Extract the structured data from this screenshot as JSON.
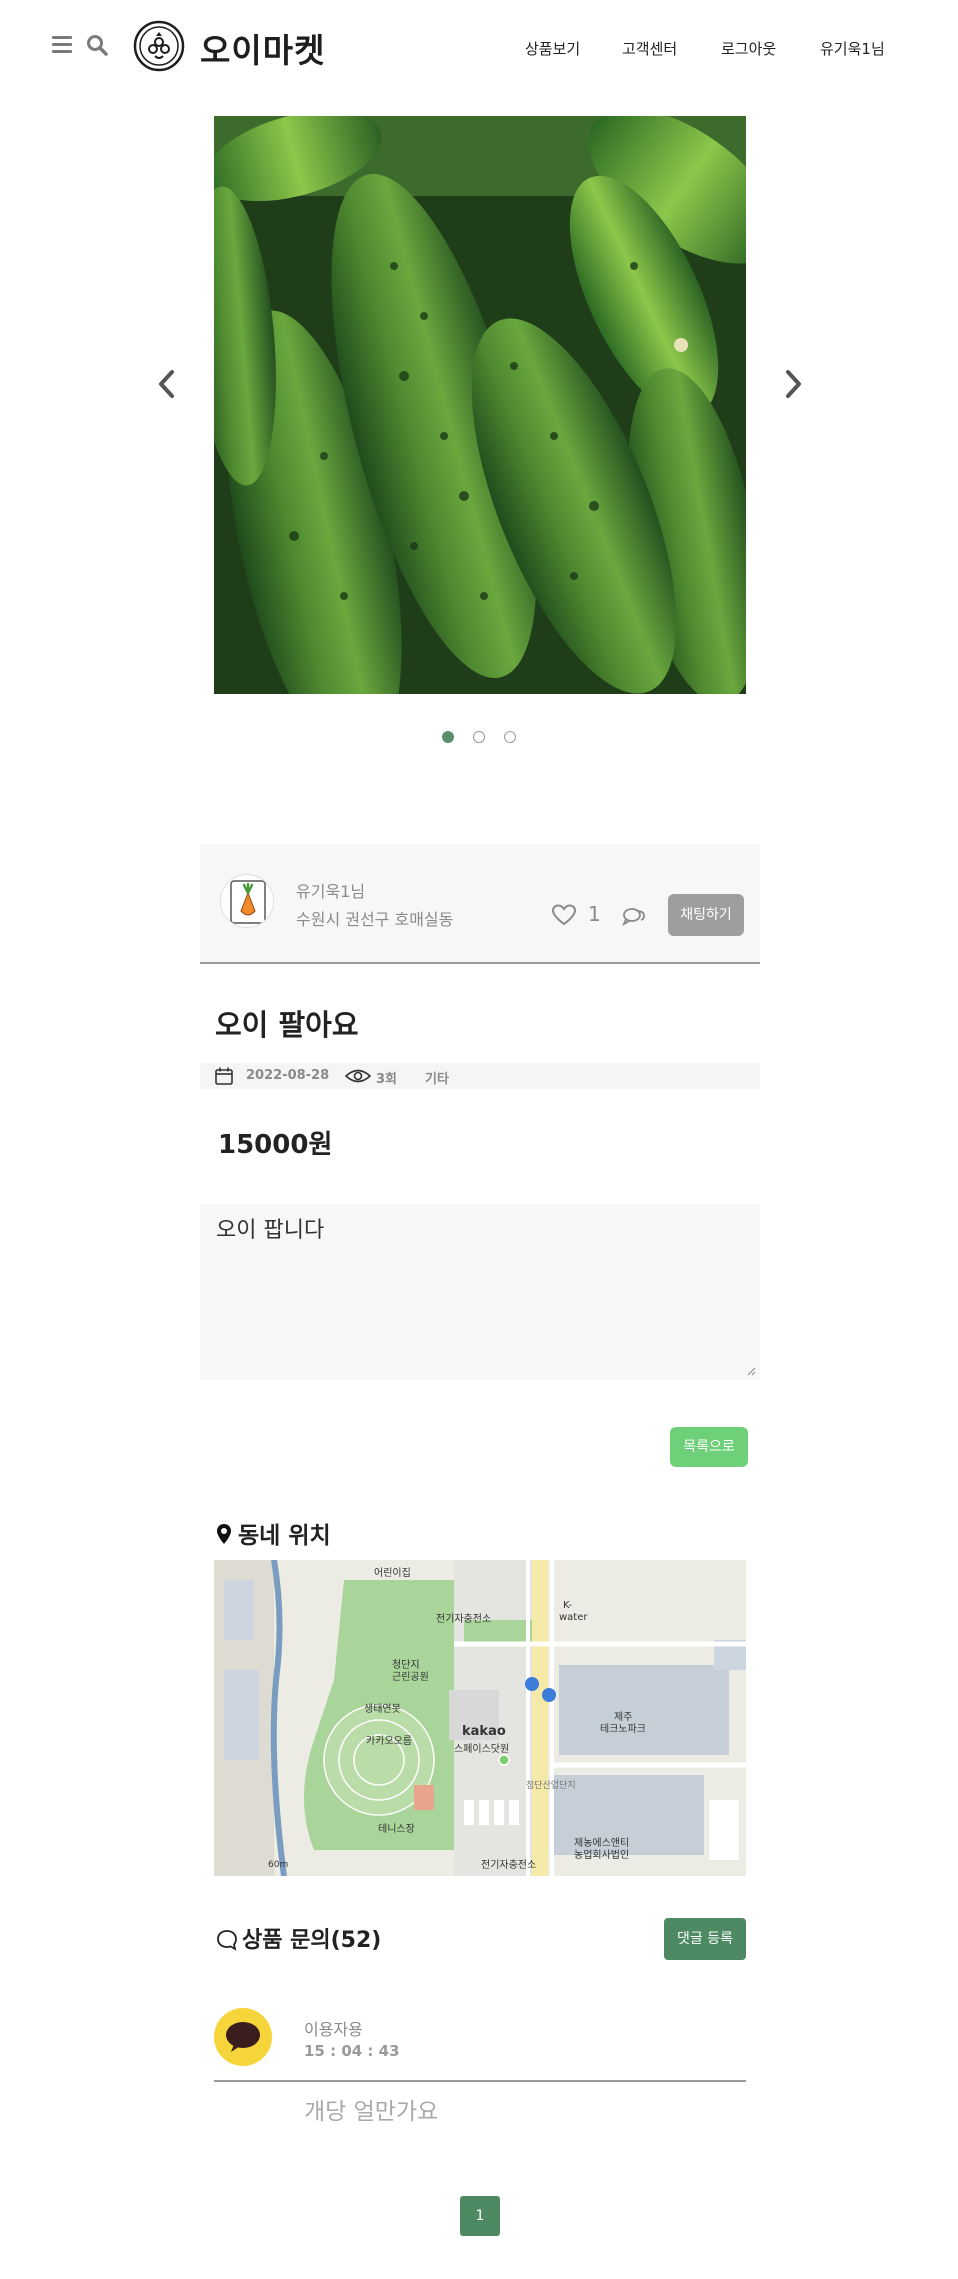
{
  "header": {
    "brand": "오이마켓",
    "nav": [
      {
        "label": "상품보기"
      },
      {
        "label": "고객센터"
      },
      {
        "label": "로그아웃"
      },
      {
        "label": "유기욱1님"
      }
    ]
  },
  "carousel": {
    "active_index": 0,
    "slides": 3
  },
  "seller": {
    "name": "유기욱1님",
    "location": "수원시 권선구 호매실동",
    "likes": "1",
    "chat_label": "채팅하기"
  },
  "post": {
    "title": "오이 팔아요",
    "date": "2022-08-28",
    "views": "3회",
    "category": "기타",
    "price": "15000원",
    "description": "오이 팝니다",
    "list_label": "목록으로"
  },
  "location": {
    "heading": "동네 위치",
    "map_labels": {
      "a": "어린이집",
      "b": "전기자충전소",
      "c": "청단지",
      "c2": "근린공원",
      "d": "K-",
      "d2": "water",
      "e": "생태연못",
      "f": "카카오오름",
      "g": "kakao",
      "g2": "스페이스닷원",
      "h": "제주",
      "h2": "테크노파크",
      "i": "첨단산업단지",
      "j": "테니스장",
      "k": "전기자충전소",
      "l": "제농에스앤티",
      "l2": "농업회사법인",
      "scale": "60m"
    }
  },
  "comments": {
    "heading": "상품 문의",
    "count": "(52)",
    "add_label": "댓글 등록",
    "items": [
      {
        "author": "이용자용",
        "time": "15 : 04 : 43",
        "text": "개당 얼만가요"
      }
    ]
  },
  "pagination": {
    "current": "1"
  },
  "colors": {
    "accent_green": "#4d8a64",
    "light_green": "#6fd07a",
    "gray_button": "#9e9e9e",
    "kakao_yellow": "#f5d53a"
  }
}
